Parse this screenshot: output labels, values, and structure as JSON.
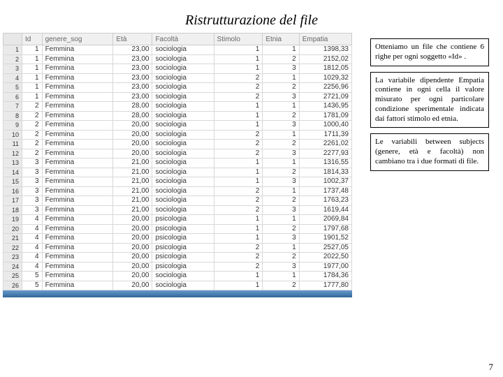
{
  "title": "Ristrutturazione del file",
  "columns": [
    "Id",
    "genere_sog",
    "Età",
    "Facoltà",
    "Stimolo",
    "Etnia",
    "Empatia"
  ],
  "rows": [
    {
      "n": 1,
      "id": 1,
      "gen": "Femmina",
      "eta": "23,00",
      "fac": "sociologia",
      "stim": 1,
      "etn": 1,
      "emp": "1398,33"
    },
    {
      "n": 2,
      "id": 1,
      "gen": "Femmina",
      "eta": "23,00",
      "fac": "sociologia",
      "stim": 1,
      "etn": 2,
      "emp": "2152,02"
    },
    {
      "n": 3,
      "id": 1,
      "gen": "Femmina",
      "eta": "23,00",
      "fac": "sociologia",
      "stim": 1,
      "etn": 3,
      "emp": "1812,05"
    },
    {
      "n": 4,
      "id": 1,
      "gen": "Femmina",
      "eta": "23,00",
      "fac": "sociologia",
      "stim": 2,
      "etn": 1,
      "emp": "1029,32"
    },
    {
      "n": 5,
      "id": 1,
      "gen": "Femmina",
      "eta": "23,00",
      "fac": "sociologia",
      "stim": 2,
      "etn": 2,
      "emp": "2256,96"
    },
    {
      "n": 6,
      "id": 1,
      "gen": "Femmina",
      "eta": "23,00",
      "fac": "sociologia",
      "stim": 2,
      "etn": 3,
      "emp": "2721,09"
    },
    {
      "n": 7,
      "id": 2,
      "gen": "Femmina",
      "eta": "28,00",
      "fac": "sociologia",
      "stim": 1,
      "etn": 1,
      "emp": "1436,95"
    },
    {
      "n": 8,
      "id": 2,
      "gen": "Femmina",
      "eta": "28,00",
      "fac": "sociologia",
      "stim": 1,
      "etn": 2,
      "emp": "1781,09"
    },
    {
      "n": 9,
      "id": 2,
      "gen": "Femmina",
      "eta": "20,00",
      "fac": "sociologia",
      "stim": 1,
      "etn": 3,
      "emp": "1000,40"
    },
    {
      "n": 10,
      "id": 2,
      "gen": "Femmina",
      "eta": "20,00",
      "fac": "sociologia",
      "stim": 2,
      "etn": 1,
      "emp": "1711,39"
    },
    {
      "n": 11,
      "id": 2,
      "gen": "Femmina",
      "eta": "20,00",
      "fac": "sociologia",
      "stim": 2,
      "etn": 2,
      "emp": "2261,02"
    },
    {
      "n": 12,
      "id": 2,
      "gen": "Femmina",
      "eta": "20,00",
      "fac": "sociologia",
      "stim": 2,
      "etn": 3,
      "emp": "2277,93"
    },
    {
      "n": 13,
      "id": 3,
      "gen": "Femmina",
      "eta": "21,00",
      "fac": "sociologia",
      "stim": 1,
      "etn": 1,
      "emp": "1316,55"
    },
    {
      "n": 14,
      "id": 3,
      "gen": "Femmina",
      "eta": "21,00",
      "fac": "sociologia",
      "stim": 1,
      "etn": 2,
      "emp": "1814,33"
    },
    {
      "n": 15,
      "id": 3,
      "gen": "Femmina",
      "eta": "21,00",
      "fac": "sociologia",
      "stim": 1,
      "etn": 3,
      "emp": "1002,37"
    },
    {
      "n": 16,
      "id": 3,
      "gen": "Femmina",
      "eta": "21,00",
      "fac": "sociologia",
      "stim": 2,
      "etn": 1,
      "emp": "1737,48"
    },
    {
      "n": 17,
      "id": 3,
      "gen": "Femmina",
      "eta": "21,00",
      "fac": "sociologia",
      "stim": 2,
      "etn": 2,
      "emp": "1763,23"
    },
    {
      "n": 18,
      "id": 3,
      "gen": "Femmina",
      "eta": "21,00",
      "fac": "sociologia",
      "stim": 2,
      "etn": 3,
      "emp": "1619,44"
    },
    {
      "n": 19,
      "id": 4,
      "gen": "Femmina",
      "eta": "20,00",
      "fac": "psicologia",
      "stim": 1,
      "etn": 1,
      "emp": "2069,84"
    },
    {
      "n": 20,
      "id": 4,
      "gen": "Femmina",
      "eta": "20,00",
      "fac": "psicologia",
      "stim": 1,
      "etn": 2,
      "emp": "1797,68"
    },
    {
      "n": 21,
      "id": 4,
      "gen": "Femmina",
      "eta": "20,00",
      "fac": "psicologia",
      "stim": 1,
      "etn": 3,
      "emp": "1901,52"
    },
    {
      "n": 22,
      "id": 4,
      "gen": "Femmina",
      "eta": "20,00",
      "fac": "psicologia",
      "stim": 2,
      "etn": 1,
      "emp": "2527,05"
    },
    {
      "n": 23,
      "id": 4,
      "gen": "Femmina",
      "eta": "20,00",
      "fac": "psicologia",
      "stim": 2,
      "etn": 2,
      "emp": "2022,50"
    },
    {
      "n": 24,
      "id": 4,
      "gen": "Femmina",
      "eta": "20,00",
      "fac": "psicologia",
      "stim": 2,
      "etn": 3,
      "emp": "1977,00"
    },
    {
      "n": 25,
      "id": 5,
      "gen": "Femmina",
      "eta": "20,00",
      "fac": "sociologia",
      "stim": 1,
      "etn": 1,
      "emp": "1784,36"
    },
    {
      "n": 26,
      "id": 5,
      "gen": "Femmina",
      "eta": "20,00",
      "fac": "sociologia",
      "stim": 1,
      "etn": 2,
      "emp": "1777,80"
    }
  ],
  "notes": {
    "p1": "Otteniamo un file che contiene 6 righe per ogni soggetto «Id» .",
    "p2": "La variabile dipendente Empatia contiene in ogni cella il valore misurato per ogni particolare condizione sperimentale indicata dai fattori stimolo ed etnia.",
    "p3": "Le variabili between subjects (genere, età e facoltà) non cambiano tra i due formati di file."
  },
  "page_number": "7"
}
